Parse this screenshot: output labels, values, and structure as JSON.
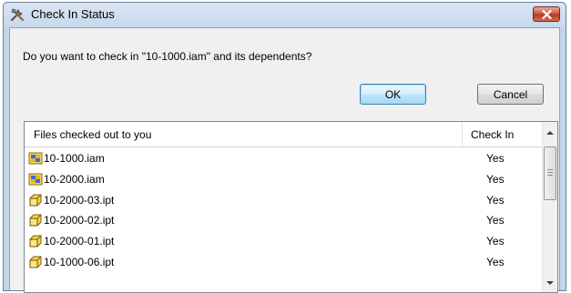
{
  "window": {
    "title": "Check In Status",
    "icon": "tools-icon"
  },
  "dialog": {
    "question": "Do you want to check in \"10-1000.iam\" and its dependents?",
    "ok_label": "OK",
    "cancel_label": "Cancel"
  },
  "list": {
    "columns": [
      "Files checked out to you",
      "Check In"
    ],
    "rows": [
      {
        "name": "10-1000.iam",
        "status": "Yes",
        "icon": "assembly-file-icon"
      },
      {
        "name": "10-2000.iam",
        "status": "Yes",
        "icon": "assembly-file-icon"
      },
      {
        "name": "10-2000-03.ipt",
        "status": "Yes",
        "icon": "part-file-icon"
      },
      {
        "name": "10-2000-02.ipt",
        "status": "Yes",
        "icon": "part-file-icon"
      },
      {
        "name": "10-2000-01.ipt",
        "status": "Yes",
        "icon": "part-file-icon"
      },
      {
        "name": "10-1000-06.ipt",
        "status": "Yes",
        "icon": "part-file-icon"
      }
    ]
  },
  "colors": {
    "close_red": "#c7503c",
    "title_bar": "#c9d8ec",
    "button_ok_border": "#3c7fb1"
  }
}
